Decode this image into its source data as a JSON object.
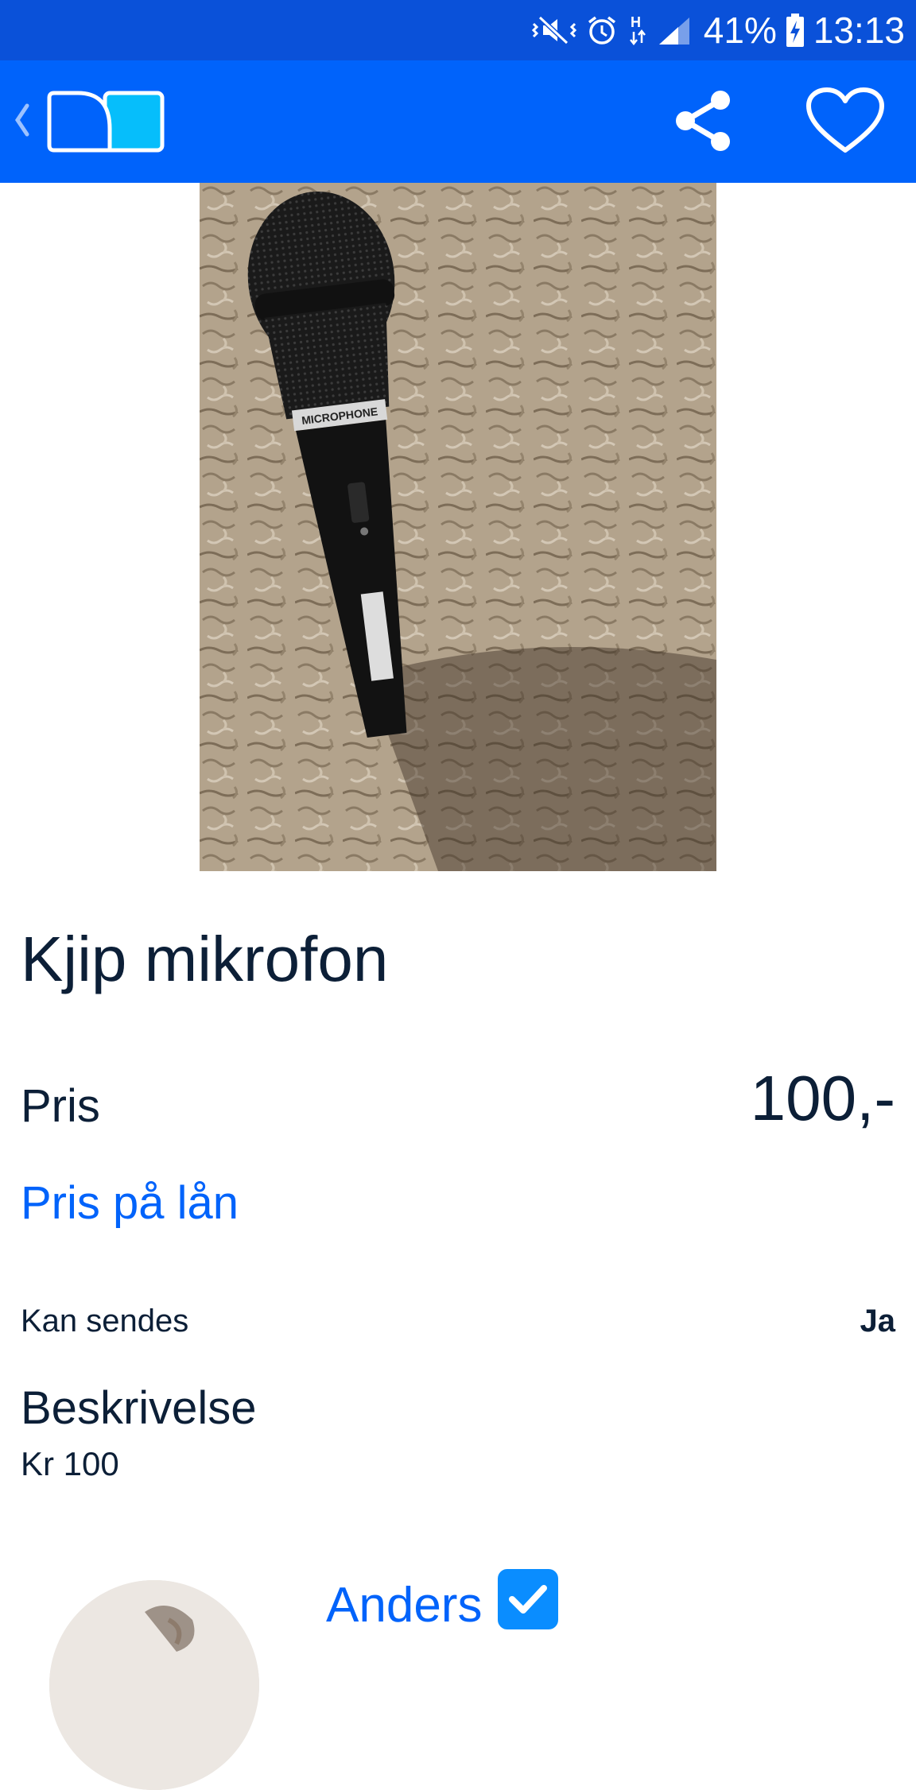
{
  "status_bar": {
    "battery_percent": "41%",
    "time": "13:13",
    "icons": [
      "vibrate-mute-icon",
      "alarm-icon",
      "hspa-data-icon",
      "signal-icon",
      "battery-charging-icon"
    ]
  },
  "app_bar": {
    "back_icon": "chevron-left-icon",
    "logo": "finn-logo",
    "share_icon": "share-icon",
    "favorite_icon": "heart-outline-icon",
    "colors": {
      "background": "#0063fb",
      "status_bar": "#0a51d9"
    }
  },
  "product": {
    "image_text": "MICROPHONE",
    "title": "Kjip mikrofon",
    "price_label": "Pris",
    "price_value": "100,-",
    "loan_link": "Pris på lån",
    "shipping_label": "Kan sendes",
    "shipping_value": "Ja",
    "description_heading": "Beskrivelse",
    "description_text": "Kr 100"
  },
  "seller": {
    "name": "Anders",
    "verified": true
  }
}
